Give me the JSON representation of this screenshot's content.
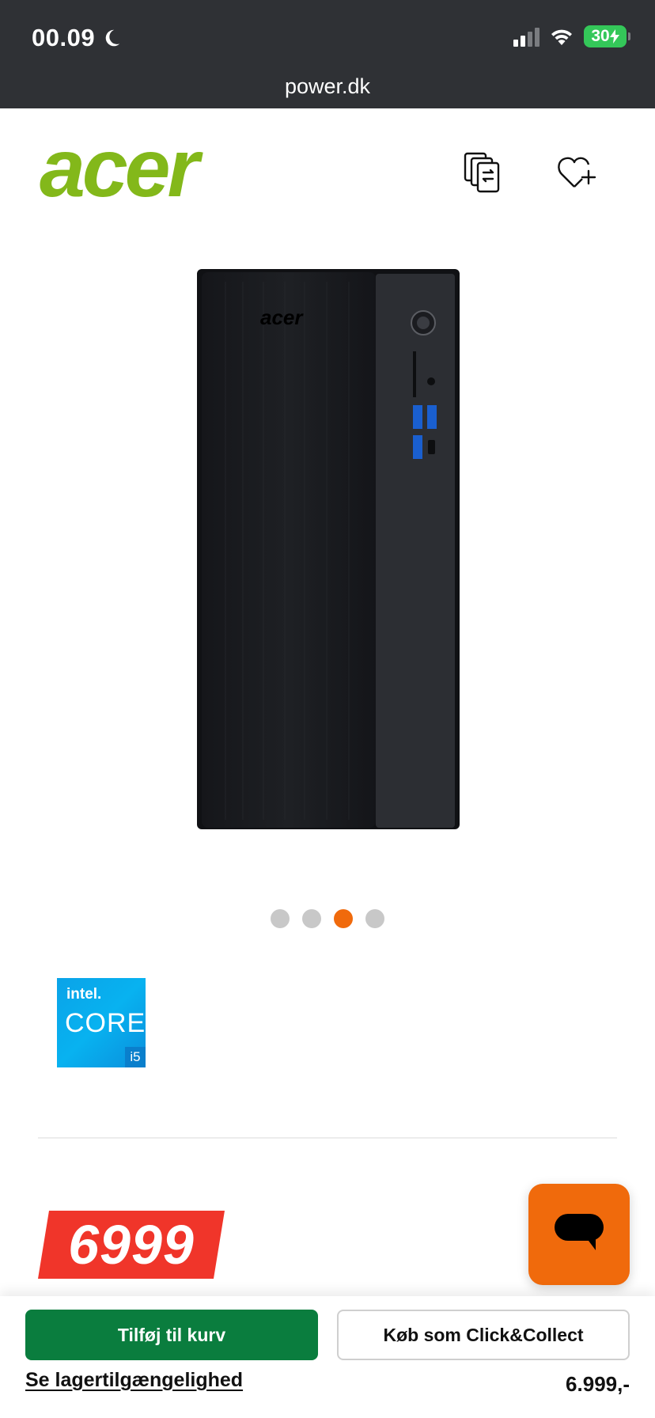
{
  "status_bar": {
    "time": "00.09",
    "battery": "30"
  },
  "browser": {
    "url": "power.dk"
  },
  "header": {
    "brand_logo": "acer",
    "compare_icon": "compare-icon",
    "wishlist_icon": "heart-plus-icon"
  },
  "product_image": {
    "device_logo": "acer",
    "alt": "acer-desktop-tower"
  },
  "carousel": {
    "total": 4,
    "active_index": 2,
    "active_color": "#f06a0c",
    "inactive_color": "#c8c8c8"
  },
  "badge": {
    "brand": "intel.",
    "line": "CORE",
    "tier": "i5"
  },
  "price": {
    "tag": "6999",
    "tag_color": "#f0352a",
    "display": "6.999,-"
  },
  "actions": {
    "add_to_cart": "Tilføj til kurv",
    "click_collect": "Køb som Click&Collect",
    "stock_link": "Se lagertilgængelighed"
  },
  "colors": {
    "brand_green": "#83b81a",
    "cart_green": "#0a7d3e",
    "chat_orange": "#f06a0c"
  }
}
